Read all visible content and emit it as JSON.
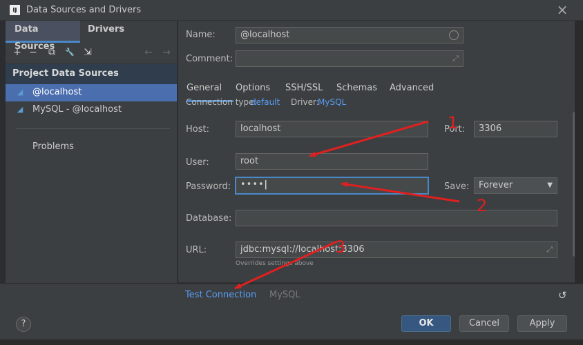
{
  "window": {
    "app_icon": "IJ",
    "title": "Data Sources and Drivers",
    "close_icon": "×"
  },
  "left": {
    "tabs": [
      "Data Sources",
      "Drivers"
    ],
    "toolbar": {
      "add": "+",
      "remove": "−",
      "duplicate": "⧉",
      "properties": "🔧",
      "import": "⇲",
      "back": "←",
      "forward": "→"
    },
    "section_header": "Project Data Sources",
    "items": [
      {
        "label": "@localhost",
        "icon": "database-icon",
        "selected": true
      },
      {
        "label": "MySQL - @localhost",
        "icon": "database-icon",
        "selected": false
      }
    ],
    "problems": "Problems"
  },
  "right": {
    "name_label": "Name:",
    "name_value": "@localhost",
    "comment_label": "Comment:",
    "comment_value": "",
    "tabs": [
      "General",
      "Options",
      "SSH/SSL",
      "Schemas",
      "Advanced"
    ],
    "connection_type_label": "Connection type:",
    "connection_type_value": "default",
    "driver_label": "Driver:",
    "driver_value": "MySQL",
    "host_label": "Host:",
    "host_value": "localhost",
    "port_label": "Port:",
    "port_value": "3306",
    "user_label": "User:",
    "user_value": "root",
    "password_label": "Password:",
    "password_value": "••••",
    "save_label": "Save:",
    "save_value": "Forever",
    "database_label": "Database:",
    "database_value": "",
    "url_label": "URL:",
    "url_value": "jdbc:mysql://localhost:3306",
    "url_hint": "Overrides settings above"
  },
  "footer": {
    "test_connection": "Test Connection",
    "mysql": "MySQL",
    "help": "?",
    "ok": "OK",
    "cancel": "Cancel",
    "apply": "Apply"
  },
  "annotations": {
    "labels": [
      "1",
      "2",
      "3"
    ],
    "color": "#e02020"
  },
  "colors": {
    "accent": "#4a88c7",
    "selection": "#4b6eaf",
    "link": "#589df6"
  }
}
